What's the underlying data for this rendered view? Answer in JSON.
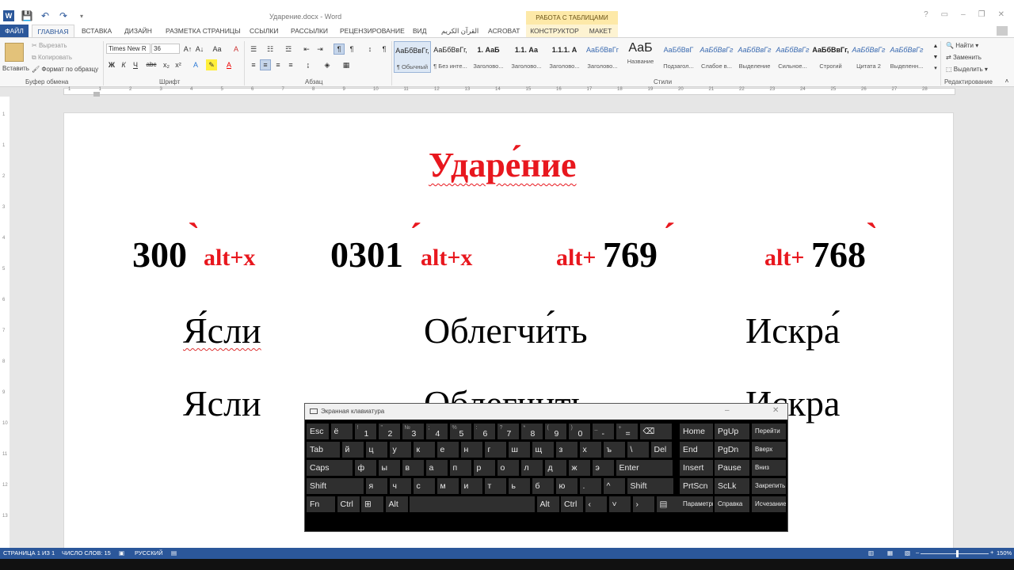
{
  "window": {
    "doc_title": "Ударение.docx - Word",
    "table_tools": "РАБОТА С ТАБЛИЦАМИ",
    "controls": [
      "?",
      "▭",
      "–",
      "❐",
      "✕"
    ]
  },
  "tabs": [
    "ФАЙЛ",
    "ГЛАВНАЯ",
    "ВСТАВКА",
    "ДИЗАЙН",
    "РАЗМЕТКА СТРАНИЦЫ",
    "ССЫЛКИ",
    "РАССЫЛКИ",
    "РЕЦЕНЗИРОВАНИЕ",
    "ВИД",
    "القرآن الكريم",
    "ACROBAT",
    "КОНСТРУКТОР",
    "МАКЕТ"
  ],
  "clipboard": {
    "paste": "Вставить",
    "cut": "Вырезать",
    "copy": "Копировать",
    "format": "Формат по образцу",
    "label": "Буфер обмена"
  },
  "font": {
    "name": "Times New R",
    "size": "36",
    "label": "Шрифт",
    "b": "Ж",
    "i": "К",
    "u": "Ч",
    "strike": "abc",
    "sub": "x₂",
    "sup": "x²",
    "grow": "A↑",
    "shrink": "A↓",
    "case": "Aa",
    "clear": "A"
  },
  "paragraph": {
    "label": "Абзац",
    "pilcrow": "¶"
  },
  "styles": {
    "label": "Стили",
    "items": [
      {
        "sample": "АаБбВвГг,",
        "name": "¶ Обычный"
      },
      {
        "sample": "АаБбВвГг,",
        "name": "¶ Без инте..."
      },
      {
        "sample": "1.  АаБ",
        "name": "Заголово..."
      },
      {
        "sample": "1.1.  Аа",
        "name": "Заголово..."
      },
      {
        "sample": "1.1.1.  А",
        "name": "Заголово..."
      },
      {
        "sample": "АаБбВвГг",
        "name": "Заголово..."
      },
      {
        "sample": "АаБ",
        "name": "Название"
      },
      {
        "sample": "АаБбВвГ",
        "name": "Подзагол..."
      },
      {
        "sample": "АаБбВвГг",
        "name": "Слабое в..."
      },
      {
        "sample": "АаБбВвГг",
        "name": "Выделение"
      },
      {
        "sample": "АаБбВвГг",
        "name": "Сильное..."
      },
      {
        "sample": "АаБбВвГг,",
        "name": "Строгий"
      },
      {
        "sample": "АаБбВвГг",
        "name": "Цитата 2"
      },
      {
        "sample": "АаБбВвГг",
        "name": "Выделенн..."
      }
    ]
  },
  "editing": {
    "label": "Редактирование",
    "find": "Найти",
    "replace": "Заменить",
    "select": "Выделить"
  },
  "ruler": [
    "1",
    "1",
    "2",
    "3",
    "4",
    "5",
    "6",
    "7",
    "8",
    "9",
    "10",
    "11",
    "12",
    "13",
    "14",
    "15",
    "16",
    "17",
    "18",
    "19",
    "20",
    "21",
    "22",
    "23",
    "24",
    "25",
    "26",
    "27",
    "28"
  ],
  "vruler": [
    "1",
    "1",
    "2",
    "3",
    "4",
    "5",
    "6",
    "7",
    "8",
    "9",
    "10",
    "11",
    "12",
    "13"
  ],
  "document": {
    "title": "Ударе́ние",
    "codes": [
      {
        "num": "300",
        "mark": "`",
        "key": "alt+x"
      },
      {
        "num": "0301",
        "mark": "´",
        "key": "alt+x"
      },
      {
        "key": "alt+",
        "num": "769",
        "mark": "´"
      },
      {
        "key": "alt+",
        "num": "768",
        "mark": "`"
      }
    ],
    "accented": [
      "Я́сли",
      "Облегчи́ть",
      "Искра́"
    ],
    "plain": [
      "Ясли",
      "Облегчить",
      "Искра"
    ]
  },
  "osk": {
    "title": "Экранная клавиатура",
    "row1": [
      {
        "m": "Esc"
      },
      {
        "m": "ё"
      },
      {
        "s": "!",
        "m": "1"
      },
      {
        "s": "\"",
        "m": "2"
      },
      {
        "s": "№",
        "m": "3"
      },
      {
        "s": ";",
        "m": "4"
      },
      {
        "s": "%",
        "m": "5"
      },
      {
        "s": ":",
        "m": "6"
      },
      {
        "s": "?",
        "m": "7"
      },
      {
        "s": "*",
        "m": "8"
      },
      {
        "s": "(",
        "m": "9"
      },
      {
        "s": ")",
        "m": "0"
      },
      {
        "s": "_",
        "m": "-"
      },
      {
        "s": "+",
        "m": "="
      },
      {
        "m": "⌫"
      }
    ],
    "row2": [
      "Tab",
      "й",
      "ц",
      "у",
      "к",
      "е",
      "н",
      "г",
      "ш",
      "щ",
      "з",
      "х",
      "ъ",
      "\\",
      "Del"
    ],
    "row3": [
      "Caps",
      "ф",
      "ы",
      "в",
      "а",
      "п",
      "р",
      "о",
      "л",
      "д",
      "ж",
      "э",
      "Enter"
    ],
    "row4": [
      "Shift",
      "я",
      "ч",
      "с",
      "м",
      "и",
      "т",
      "ь",
      "б",
      "ю",
      ".",
      "^",
      "Shift"
    ],
    "row5": [
      "Fn",
      "Ctrl",
      "⊞",
      "Alt",
      "",
      "Alt",
      "Ctrl",
      "‹",
      "˅",
      "›",
      "▤"
    ],
    "nav": [
      [
        "Home",
        "PgUp",
        "Перейти"
      ],
      [
        "End",
        "PgDn",
        "Вверх"
      ],
      [
        "Insert",
        "Pause",
        "Вниз"
      ],
      [
        "PrtScn",
        "ScLk",
        "Закрепить"
      ],
      [
        "Параметры",
        "Справка",
        "Исчезание"
      ]
    ]
  },
  "status": {
    "page": "СТРАНИЦА 1 ИЗ 1",
    "words": "ЧИСЛО СЛОВ: 15",
    "lang": "РУССКИЙ",
    "zoom": "150%"
  }
}
